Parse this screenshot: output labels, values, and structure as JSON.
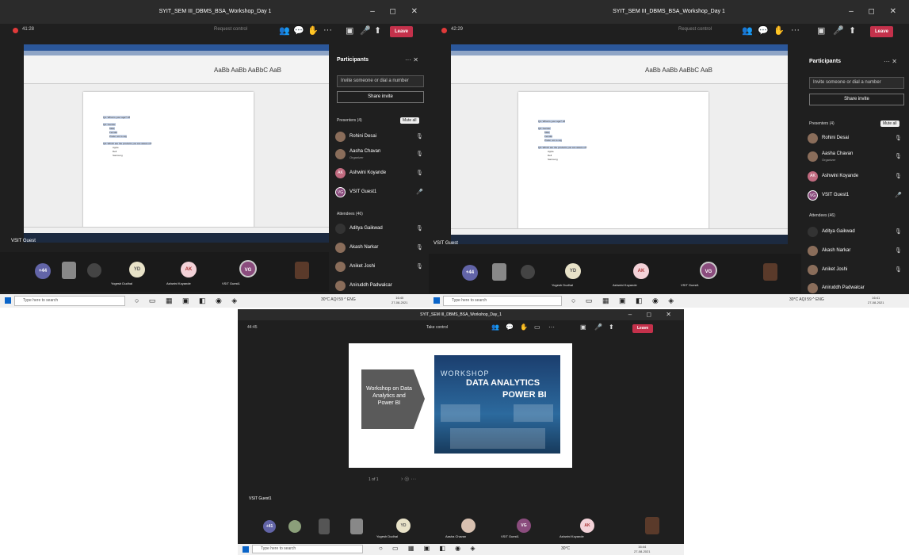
{
  "window_title": "SYIT_SEM III_DBMS_BSA_Workshop_Day 1",
  "shot1": {
    "timer": "41:28",
    "request_control": "Request control",
    "leave": "Leave",
    "doc": {
      "q1": "Q1: What is your age? 18",
      "q2": "Q2: Gender",
      "q2_options": [
        "Male",
        "Female",
        "Prefer not to say"
      ],
      "q3": "Q3: Which are the products you are aware of?",
      "q3_options": [
        "Apple",
        "Dell",
        "Samsung"
      ]
    },
    "presenter_label": "VSIT Guest",
    "panel": {
      "title": "Participants",
      "invite_placeholder": "Invite someone or dial a number",
      "share_invite": "Share invite",
      "presenters_header": "Presenters (4)",
      "mute_all": "Mute all",
      "presenters": [
        {
          "name": "Rohini Desai",
          "role": ""
        },
        {
          "name": "Aasha Chavan",
          "role": "Organizer"
        },
        {
          "name": "Ashwini Koyande",
          "role": "",
          "initials": "AK"
        },
        {
          "name": "VSIT Guest1",
          "role": "",
          "initials": "VG"
        }
      ],
      "attendees_header": "Attendees (46)",
      "attendees": [
        "Aditya Gaikwad",
        "Akash Narkar",
        "Aniket Joshi",
        "Aniruddh Padwalcar"
      ]
    },
    "strip": {
      "more": "+44",
      "tiles": [
        {
          "initials": "YD",
          "name": "Yogesh Dudhal"
        },
        {
          "initials": "AK",
          "name": "Ashwini Koyande"
        },
        {
          "initials": "VG",
          "name": "VSIT Guest1"
        }
      ]
    },
    "taskbar": {
      "search": "Type here to search",
      "tray": "30°C AQI 59 ^ ENG",
      "time": "16:40",
      "date": "27-08-2021"
    }
  },
  "shot2": {
    "timer": "42:29",
    "request_control": "Request control",
    "leave": "Leave",
    "presenter_label": "VSIT Guest",
    "panel": {
      "title": "Participants",
      "invite_placeholder": "Invite someone or dial a number",
      "share_invite": "Share invite",
      "presenters_header": "Presenters (4)",
      "mute_all": "Mute all",
      "presenters": [
        {
          "name": "Rohini Desai",
          "role": ""
        },
        {
          "name": "Aasha Chavan",
          "role": "Organizer"
        },
        {
          "name": "Ashwini Koyande",
          "role": "",
          "initials": "AK"
        },
        {
          "name": "VSIT Guest1",
          "role": "",
          "initials": "VG"
        }
      ],
      "attendees_header": "Attendees (46)",
      "attendees": [
        "Aditya Gaikwad",
        "Akash Narkar",
        "Aniket Joshi",
        "Aniruddh Padwalcar"
      ]
    },
    "strip": {
      "more": "+44",
      "tiles": [
        {
          "initials": "YD",
          "name": "Yogesh Dudhal"
        },
        {
          "initials": "AK",
          "name": "Ashwini Koyande"
        },
        {
          "initials": "VG",
          "name": "VSIT Guest1"
        }
      ]
    },
    "taskbar": {
      "search": "Type here to search",
      "tray": "30°C AQI 59 ^ ENG",
      "time": "16:41",
      "date": "27-08-2021"
    }
  },
  "shot3": {
    "window_title": "SYIT_SEM III_DBMS_BSA_Workshop_Day_1",
    "timer": "44:45",
    "take_control": "Take control",
    "leave": "Leave",
    "slide": {
      "box_text": "Workshop on Data Analytics and Power BI",
      "poster_line1": "WORKSHOP",
      "poster_line2": "DATA ANALYTICS",
      "poster_line3": "POWER BI",
      "page": "1 of 1"
    },
    "presenter_label": "VSIT Guest1",
    "strip": {
      "more": "+41",
      "tiles": [
        {
          "initials": "YD",
          "name": "Yogesh Dudhal"
        },
        {
          "initials": "",
          "name": "Aasha Chavan"
        },
        {
          "initials": "VG",
          "name": "VSIT Guest1"
        },
        {
          "initials": "AK",
          "name": "Ashwini Koyande"
        }
      ]
    },
    "taskbar": {
      "search": "Type here to search",
      "tray": "30°C",
      "time": "16:44",
      "date": "27-08-2021"
    }
  },
  "colors": {
    "leave": "#c4314b",
    "bg": "#1f1f1f",
    "accent": "#6264a7"
  }
}
